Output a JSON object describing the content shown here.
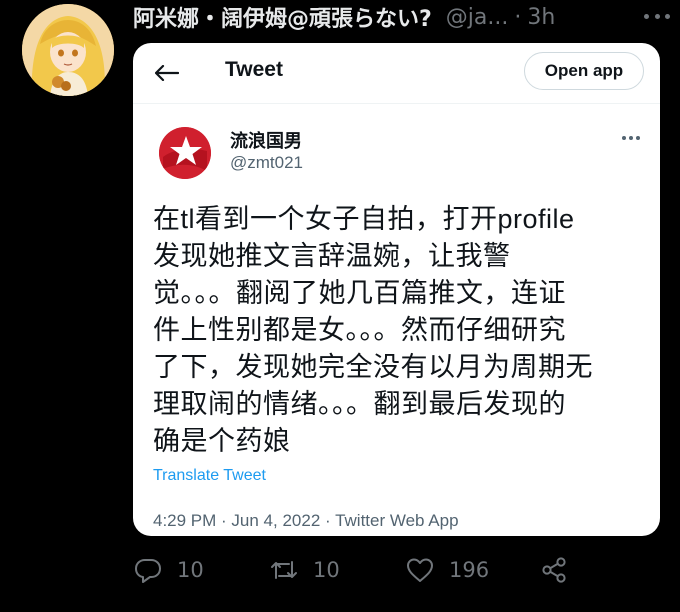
{
  "author": {
    "display_name": "阿米娜・阔伊姆@頑張らない?",
    "handle": "@ja...",
    "separator": "·",
    "time": "3h",
    "avatar_icon": "anime-avatar"
  },
  "embedded_card": {
    "title": "Tweet",
    "open_app_label": "Open app",
    "back_icon": "arrow-left-icon",
    "quoted": {
      "name": "流浪国男",
      "handle": "@zmt021",
      "avatar_icon": "red-star-logo",
      "text_lines": [
        "在tl看到一个女子自拍，打开profile",
        "发现她推文言辞温婉，让我警",
        "觉。。。翻阅了她几百篇推文，连证",
        "件上性别都是女。。。然而仔细研究",
        "了下，发现她完全没有以月为周期无",
        "理取闹的情绪。。。翻到最后发现的",
        "确是个药娘"
      ],
      "translate_label": "Translate Tweet",
      "meta": "4:29 PM · Jun 4, 2022 · Twitter Web App"
    }
  },
  "actions": {
    "reply_count": "10",
    "retweet_count": "10",
    "like_count": "196"
  },
  "colors": {
    "background": "#000000",
    "card": "#ffffff",
    "link": "#1d9bf0",
    "secondary_text": "#71767b"
  }
}
